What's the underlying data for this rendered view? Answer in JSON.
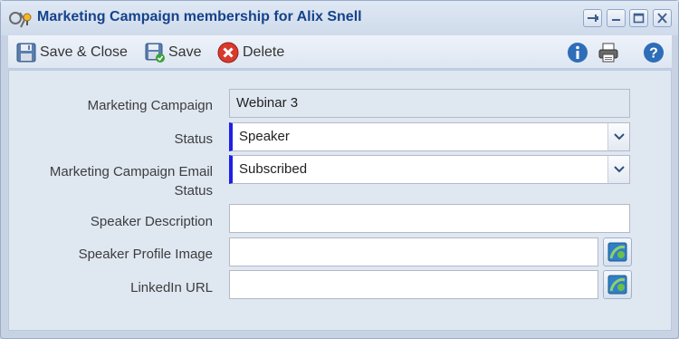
{
  "window": {
    "title": "Marketing Campaign membership for Alix Snell",
    "controls": [
      "pin-icon",
      "minimize-icon",
      "maximize-icon",
      "close-icon"
    ]
  },
  "toolbar": {
    "save_close_label": "Save & Close",
    "save_label": "Save",
    "delete_label": "Delete",
    "right_icons": [
      "info-icon",
      "print-icon",
      "help-icon"
    ]
  },
  "form": {
    "marketing_campaign": {
      "label": "Marketing Campaign",
      "value": "Webinar 3"
    },
    "status": {
      "label": "Status",
      "value": "Speaker"
    },
    "email_status": {
      "label_line1": "Marketing Campaign Email",
      "label_line2": "Status",
      "value": "Subscribed"
    },
    "speaker_description": {
      "label": "Speaker Description",
      "value": ""
    },
    "speaker_profile_image": {
      "label": "Speaker Profile Image",
      "value": ""
    },
    "linkedin_url": {
      "label": "LinkedIn URL",
      "value": ""
    }
  },
  "colors": {
    "title_text": "#15428b",
    "required_marker": "#1f1fe6",
    "panel_bg": "#dfe7f1",
    "window_bg": "#c7d3e3"
  }
}
